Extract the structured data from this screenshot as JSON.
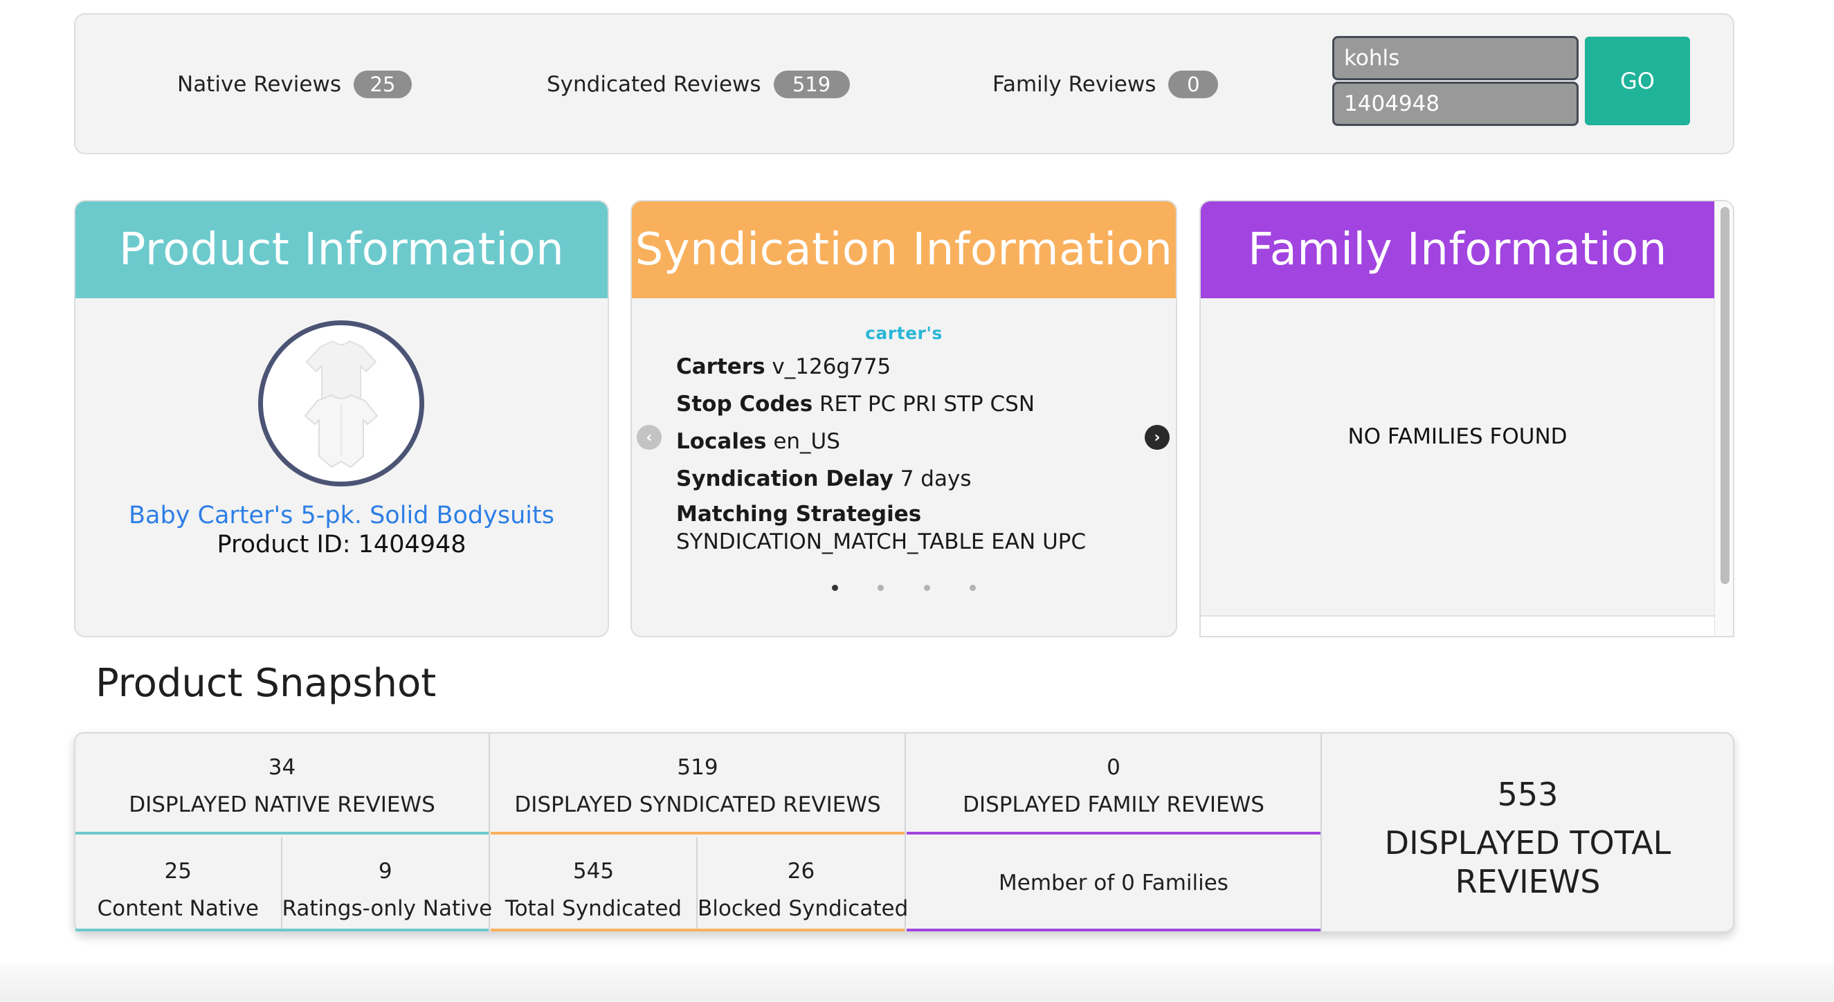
{
  "counts": {
    "native_label": "Native Reviews",
    "native_value": "25",
    "syndicated_label": "Syndicated Reviews",
    "syndicated_value": "519",
    "family_label": "Family Reviews",
    "family_value": "0"
  },
  "search": {
    "client_value": "kohls",
    "product_value": "1404948",
    "go_label": "GO"
  },
  "colors": {
    "teal": "#6ccacd",
    "orange": "#f9b05d",
    "purple": "#a144e0",
    "go_green": "#1fb39a",
    "link_blue": "#2d7fe6"
  },
  "product_card": {
    "title": "Product Information",
    "product_name": "Baby Carter's 5-pk. Solid Bodysuits",
    "product_id": "Product ID: 1404948"
  },
  "syndication_card": {
    "title": "Syndication Information",
    "logo_text": "carter's",
    "source_label": "Carters",
    "source_value": "v_126g775",
    "stop_codes_label": "Stop Codes",
    "stop_codes_value": "RET PC PRI STP CSN",
    "locales_label": "Locales",
    "locales_value": "en_US",
    "delay_label": "Syndication Delay",
    "delay_value": "7 days",
    "strategies_label": "Matching Strategies",
    "strategies_value": "SYNDICATION_MATCH_TABLE EAN UPC",
    "slides": 4,
    "active_slide": 1
  },
  "family_card": {
    "title": "Family Information",
    "empty_message": "NO FAMILIES FOUND"
  },
  "snapshot": {
    "title": "Product Snapshot",
    "native": {
      "value": "34",
      "label": "DISPLAYED NATIVE REVIEWS",
      "content_value": "25",
      "content_label": "Content Native",
      "ratings_value": "9",
      "ratings_label": "Ratings-only Native"
    },
    "syndicated": {
      "value": "519",
      "label": "DISPLAYED SYNDICATED REVIEWS",
      "total_value": "545",
      "total_label": "Total Syndicated",
      "blocked_value": "26",
      "blocked_label": "Blocked Syndicated"
    },
    "family": {
      "value": "0",
      "label": "DISPLAYED FAMILY REVIEWS",
      "member_label": "Member of 0 Families"
    },
    "total": {
      "value": "553",
      "label": "DISPLAYED TOTAL REVIEWS"
    }
  }
}
